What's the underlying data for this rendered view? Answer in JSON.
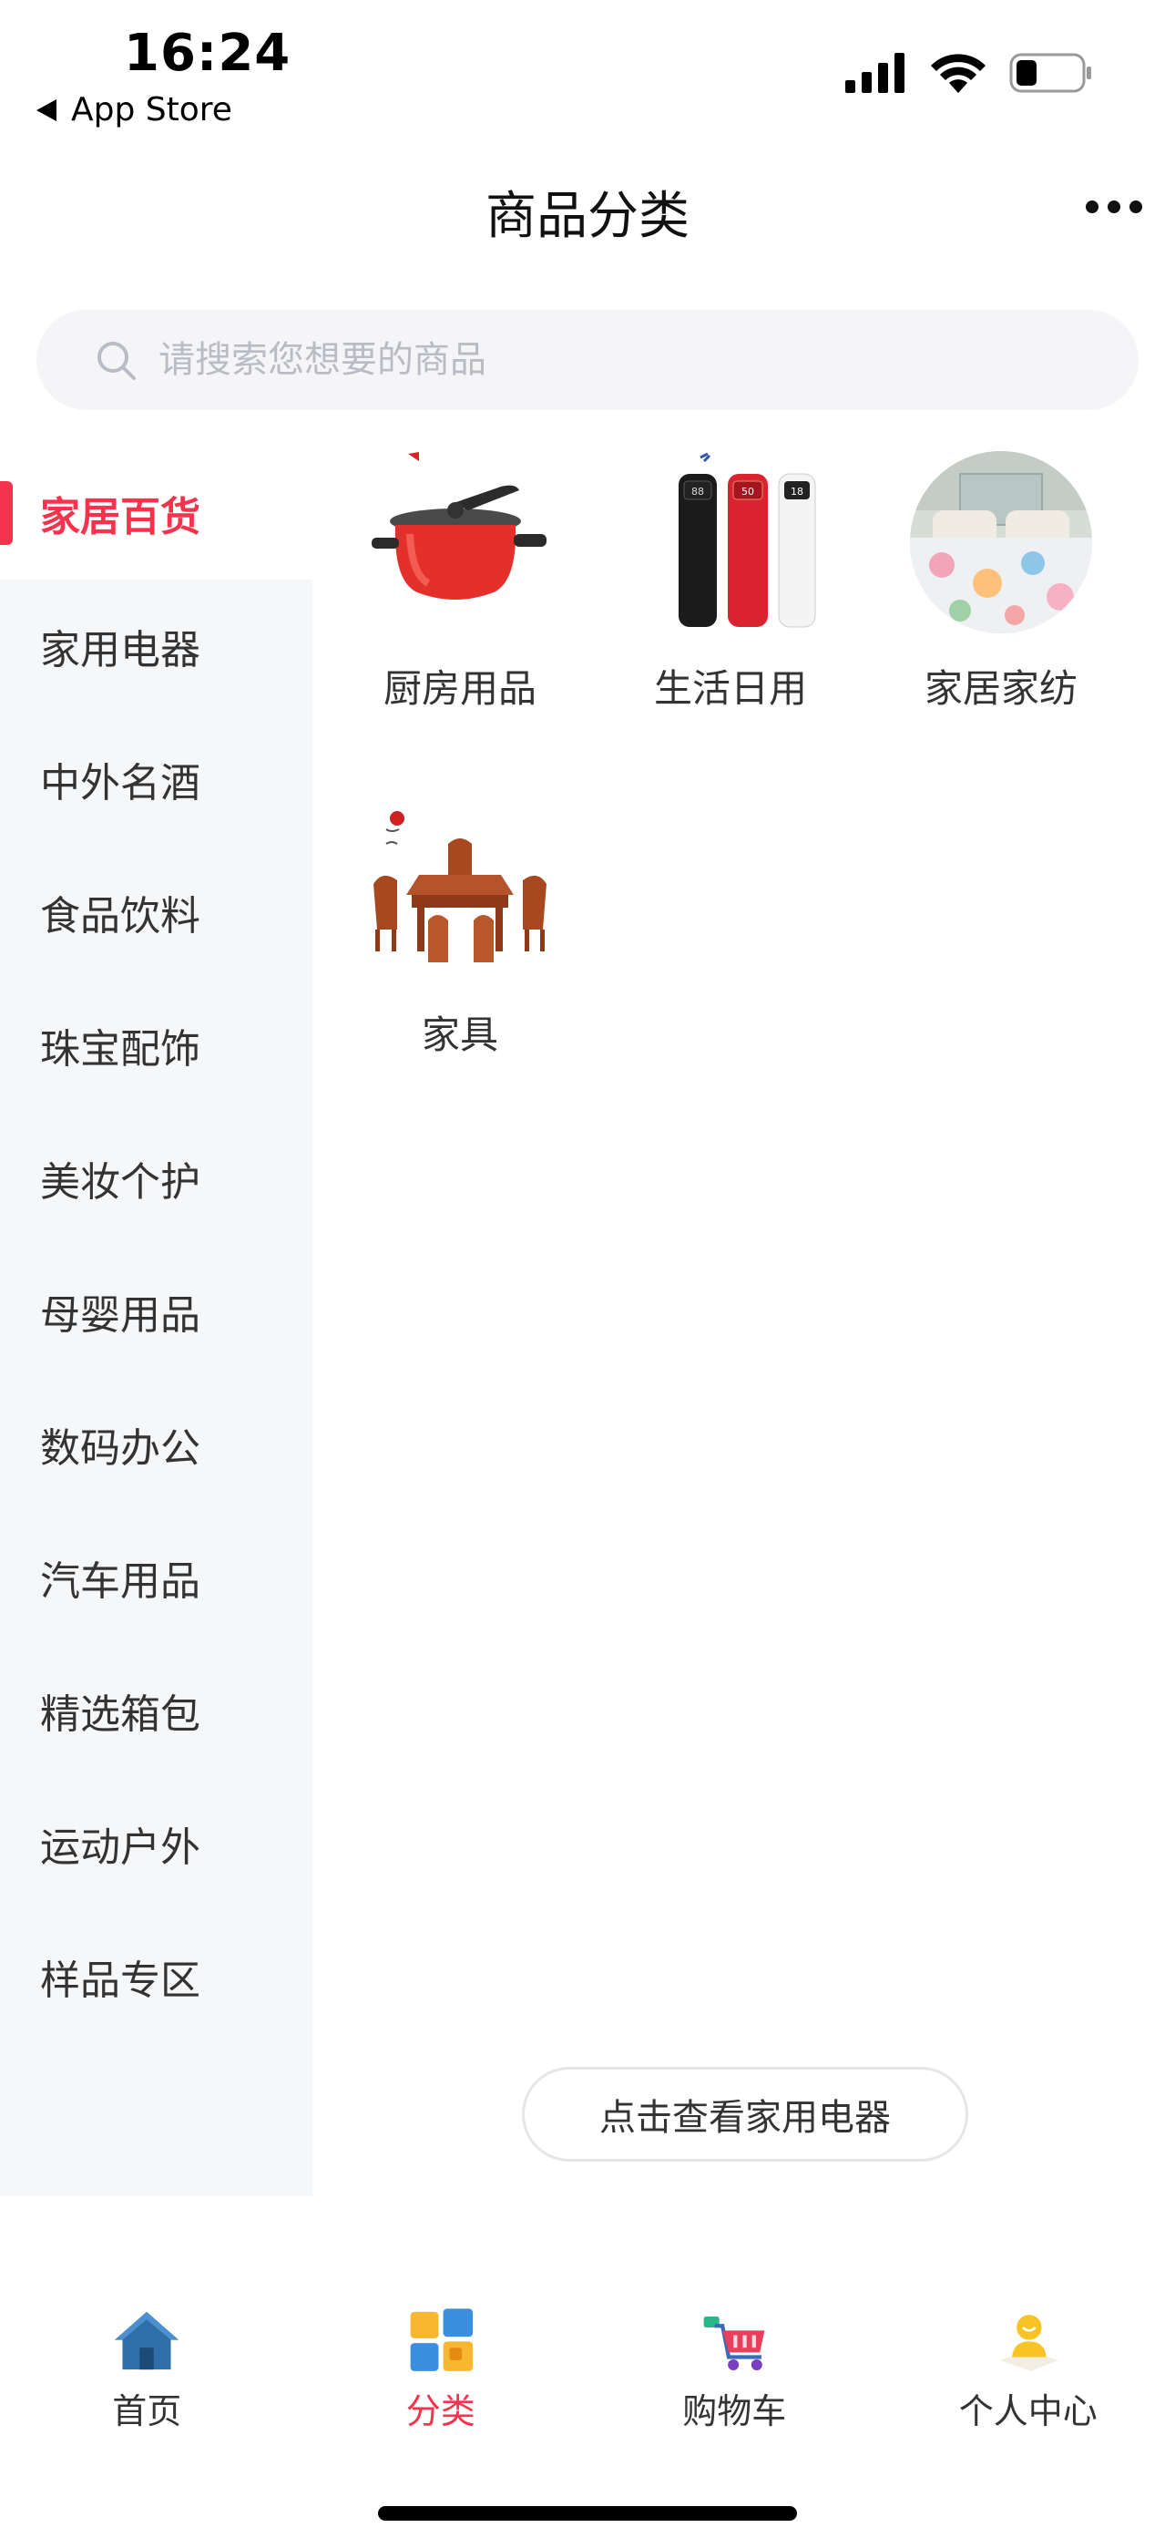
{
  "status_bar": {
    "time": "16:24",
    "back_label": "App Store"
  },
  "nav": {
    "title": "商品分类"
  },
  "search": {
    "placeholder": "请搜索您想要的商品"
  },
  "sidebar": {
    "items": [
      {
        "label": "家居百货",
        "active": true
      },
      {
        "label": "家用电器"
      },
      {
        "label": "中外名酒"
      },
      {
        "label": "食品饮料"
      },
      {
        "label": "珠宝配饰"
      },
      {
        "label": "美妆个护"
      },
      {
        "label": "母婴用品"
      },
      {
        "label": "数码办公"
      },
      {
        "label": "汽车用品"
      },
      {
        "label": "精选箱包"
      },
      {
        "label": "运动户外"
      },
      {
        "label": "样品专区"
      }
    ]
  },
  "content": {
    "categories": [
      {
        "label": "厨房用品",
        "icon": "pressure-cooker-image"
      },
      {
        "label": "生活日用",
        "icon": "thermos-bottles-image"
      },
      {
        "label": "家居家纺",
        "icon": "bedding-image"
      },
      {
        "label": "家具",
        "icon": "furniture-image"
      }
    ],
    "view_more_label": "点击查看家用电器"
  },
  "tab_bar": {
    "tabs": [
      {
        "label": "首页",
        "icon": "house-icon"
      },
      {
        "label": "分类",
        "icon": "category-icon",
        "active": true
      },
      {
        "label": "购物车",
        "icon": "cart-icon"
      },
      {
        "label": "个人中心",
        "icon": "user-icon"
      }
    ]
  },
  "colors": {
    "accent": "#f5334d",
    "sidebar_bg": "#f6f7f9",
    "search_bg": "#f5f5f7"
  }
}
